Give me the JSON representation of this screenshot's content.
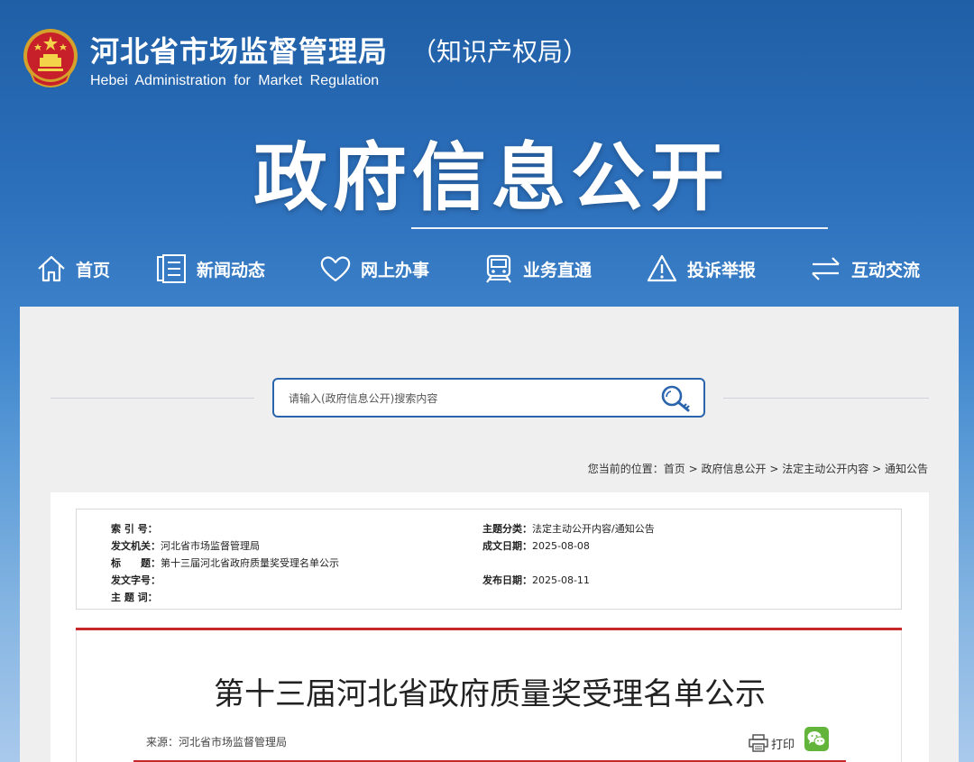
{
  "header": {
    "agency_name": "河北省市场监督管理局",
    "agency_sub": "（知识产权局）",
    "agency_en": "Hebei Administration for Market Regulation",
    "section_title": "政府信息公开"
  },
  "nav": {
    "items": [
      {
        "label": "首页",
        "icon": "home-icon"
      },
      {
        "label": "新闻动态",
        "icon": "news-icon"
      },
      {
        "label": "网上办事",
        "icon": "heart-icon"
      },
      {
        "label": "业务直通",
        "icon": "train-icon"
      },
      {
        "label": "投诉举报",
        "icon": "warning-icon"
      },
      {
        "label": "互动交流",
        "icon": "exchange-icon"
      }
    ]
  },
  "search": {
    "placeholder": "请输入(政府信息公开)搜索内容"
  },
  "breadcrumb": {
    "prefix": "您当前的位置：",
    "items": [
      "首页",
      "政府信息公开",
      "法定主动公开内容",
      "通知公告"
    ],
    "separator": ">"
  },
  "meta": {
    "index_label": "索 引 号：",
    "index_value": "",
    "issuer_label": "发文机关：",
    "issuer_value": "河北省市场监督管理局",
    "title_label": "标　　题：",
    "title_value": "第十三届河北省政府质量奖受理名单公示",
    "doc_no_label": "发文字号：",
    "doc_no_value": "",
    "keywords_label": "主 题 词：",
    "keywords_value": "",
    "category_label": "主题分类：",
    "category_value": "法定主动公开内容/通知公告",
    "created_label": "成文日期：",
    "created_value": "2025-08-08",
    "published_label": "发布日期：",
    "published_value": "2025-08-11"
  },
  "article": {
    "title": "第十三届河北省政府质量奖受理名单公示",
    "source": "来源：河北省市场监督管理局",
    "print_label": "打印"
  },
  "colors": {
    "brand_blue": "#2a64ad",
    "accent_red": "#c6282b",
    "wechat_green": "#62b53a"
  }
}
